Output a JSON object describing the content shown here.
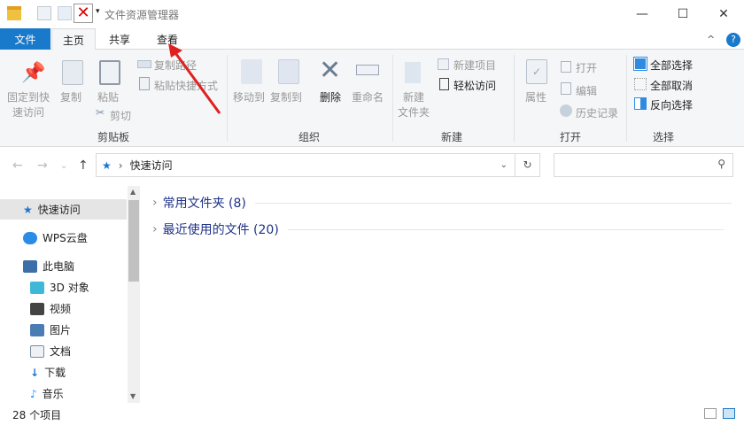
{
  "window": {
    "title": "文件资源管理器",
    "minimize": "—",
    "maximize": "☐",
    "close": "✕",
    "help": "?",
    "collapse": "^"
  },
  "tabs": [
    {
      "label": "文件"
    },
    {
      "label": "主页"
    },
    {
      "label": "共享"
    },
    {
      "label": "查看"
    }
  ],
  "ribbon": {
    "clipboard": {
      "pin": "固定到快",
      "pin2": "速访问",
      "copy": "复制",
      "paste": "粘贴",
      "copy_path": "复制路径",
      "paste_shortcut": "粘贴快捷方式",
      "cut": "剪切",
      "group": "剪贴板"
    },
    "organize": {
      "move_to": "移动到",
      "copy_to": "复制到",
      "delete": "删除",
      "rename": "重命名",
      "group": "组织"
    },
    "new": {
      "new_folder": "新建",
      "new_folder2": "文件夹",
      "new_item": "新建项目",
      "easy_access": "轻松访问",
      "group": "新建"
    },
    "open": {
      "properties": "属性",
      "open": "打开",
      "edit": "编辑",
      "history": "历史记录",
      "group": "打开"
    },
    "select": {
      "select_all": "全部选择",
      "select_none": "全部取消",
      "invert": "反向选择",
      "group": "选择"
    }
  },
  "address": {
    "path": "快速访问",
    "search_placeholder": ""
  },
  "sidebar": [
    {
      "label": "快速访问",
      "color": "#1e73d2"
    },
    {
      "label": "WPS云盘",
      "color": "#2a8ce6"
    },
    {
      "label": "此电脑",
      "color": "#3c6ea8"
    },
    {
      "label": "3D 对象",
      "color": "#3fb8d8"
    },
    {
      "label": "视频",
      "color": "#444"
    },
    {
      "label": "图片",
      "color": "#4a7db4"
    },
    {
      "label": "文档",
      "color": "#7a8da6"
    },
    {
      "label": "下载",
      "color": "#1e73d2"
    },
    {
      "label": "音乐",
      "color": "#1e90ff"
    }
  ],
  "content": {
    "sections": [
      {
        "label": "常用文件夹 (8)"
      },
      {
        "label": "最近使用的文件 (20)"
      }
    ]
  },
  "status": {
    "count": "28 个项目"
  },
  "colors": {
    "accent": "#1979ca",
    "arrow": "#e02020"
  }
}
